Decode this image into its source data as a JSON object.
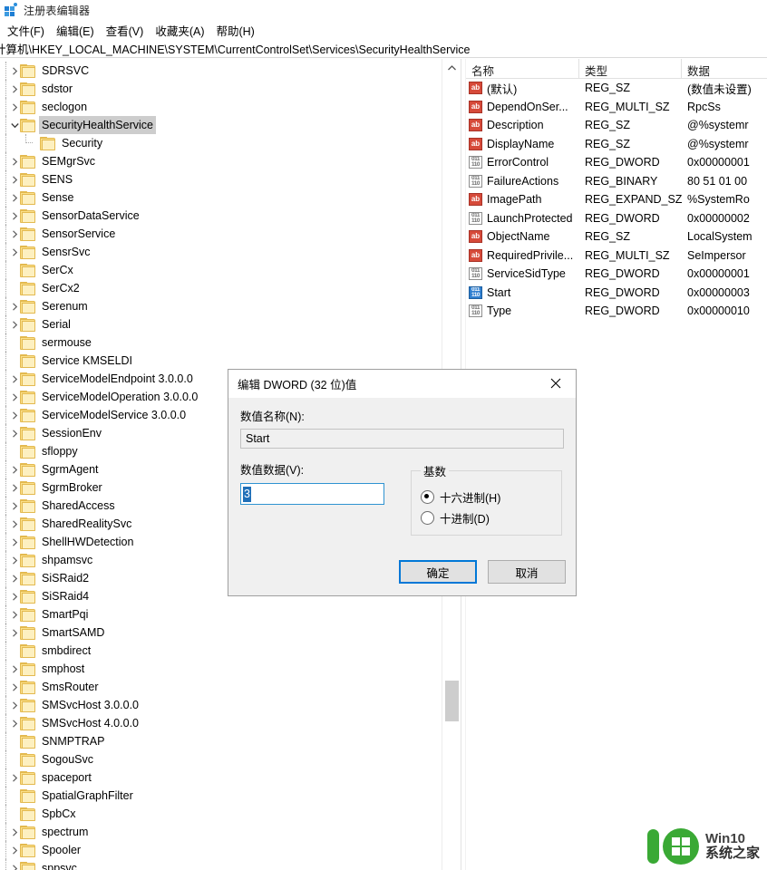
{
  "window": {
    "title": "注册表编辑器",
    "icon": "registry-editor-icon"
  },
  "menu": {
    "items": [
      {
        "label": "文件(F)",
        "name": "menu-file"
      },
      {
        "label": "编辑(E)",
        "name": "menu-edit"
      },
      {
        "label": "查看(V)",
        "name": "menu-view"
      },
      {
        "label": "收藏夹(A)",
        "name": "menu-favorites"
      },
      {
        "label": "帮助(H)",
        "name": "menu-help"
      }
    ]
  },
  "address": {
    "path": "计算机\\HKEY_LOCAL_MACHINE\\SYSTEM\\CurrentControlSet\\Services\\SecurityHealthService"
  },
  "tree": {
    "items": [
      {
        "label": "SDRSVC",
        "indent": 1,
        "expander": "collapsed",
        "selected": false
      },
      {
        "label": "sdstor",
        "indent": 1,
        "expander": "collapsed",
        "selected": false
      },
      {
        "label": "seclogon",
        "indent": 1,
        "expander": "collapsed",
        "selected": false
      },
      {
        "label": "SecurityHealthService",
        "indent": 1,
        "expander": "expanded",
        "selected": true
      },
      {
        "label": "Security",
        "indent": 2,
        "expander": "leaf",
        "selected": false
      },
      {
        "label": "SEMgrSvc",
        "indent": 1,
        "expander": "collapsed",
        "selected": false
      },
      {
        "label": "SENS",
        "indent": 1,
        "expander": "collapsed",
        "selected": false
      },
      {
        "label": "Sense",
        "indent": 1,
        "expander": "collapsed",
        "selected": false
      },
      {
        "label": "SensorDataService",
        "indent": 1,
        "expander": "collapsed",
        "selected": false
      },
      {
        "label": "SensorService",
        "indent": 1,
        "expander": "collapsed",
        "selected": false
      },
      {
        "label": "SensrSvc",
        "indent": 1,
        "expander": "collapsed",
        "selected": false
      },
      {
        "label": "SerCx",
        "indent": 1,
        "expander": "leaf",
        "selected": false
      },
      {
        "label": "SerCx2",
        "indent": 1,
        "expander": "leaf",
        "selected": false
      },
      {
        "label": "Serenum",
        "indent": 1,
        "expander": "collapsed",
        "selected": false
      },
      {
        "label": "Serial",
        "indent": 1,
        "expander": "collapsed",
        "selected": false
      },
      {
        "label": "sermouse",
        "indent": 1,
        "expander": "leaf",
        "selected": false
      },
      {
        "label": "Service KMSELDI",
        "indent": 1,
        "expander": "leaf",
        "selected": false
      },
      {
        "label": "ServiceModelEndpoint 3.0.0.0",
        "indent": 1,
        "expander": "collapsed",
        "selected": false
      },
      {
        "label": "ServiceModelOperation 3.0.0.0",
        "indent": 1,
        "expander": "collapsed",
        "selected": false
      },
      {
        "label": "ServiceModelService 3.0.0.0",
        "indent": 1,
        "expander": "collapsed",
        "selected": false
      },
      {
        "label": "SessionEnv",
        "indent": 1,
        "expander": "collapsed",
        "selected": false
      },
      {
        "label": "sfloppy",
        "indent": 1,
        "expander": "leaf",
        "selected": false
      },
      {
        "label": "SgrmAgent",
        "indent": 1,
        "expander": "collapsed",
        "selected": false
      },
      {
        "label": "SgrmBroker",
        "indent": 1,
        "expander": "collapsed",
        "selected": false
      },
      {
        "label": "SharedAccess",
        "indent": 1,
        "expander": "collapsed",
        "selected": false
      },
      {
        "label": "SharedRealitySvc",
        "indent": 1,
        "expander": "collapsed",
        "selected": false
      },
      {
        "label": "ShellHWDetection",
        "indent": 1,
        "expander": "collapsed",
        "selected": false
      },
      {
        "label": "shpamsvc",
        "indent": 1,
        "expander": "collapsed",
        "selected": false
      },
      {
        "label": "SiSRaid2",
        "indent": 1,
        "expander": "collapsed",
        "selected": false
      },
      {
        "label": "SiSRaid4",
        "indent": 1,
        "expander": "collapsed",
        "selected": false
      },
      {
        "label": "SmartPqi",
        "indent": 1,
        "expander": "collapsed",
        "selected": false
      },
      {
        "label": "SmartSAMD",
        "indent": 1,
        "expander": "collapsed",
        "selected": false
      },
      {
        "label": "smbdirect",
        "indent": 1,
        "expander": "leaf",
        "selected": false
      },
      {
        "label": "smphost",
        "indent": 1,
        "expander": "collapsed",
        "selected": false
      },
      {
        "label": "SmsRouter",
        "indent": 1,
        "expander": "collapsed",
        "selected": false
      },
      {
        "label": "SMSvcHost 3.0.0.0",
        "indent": 1,
        "expander": "collapsed",
        "selected": false
      },
      {
        "label": "SMSvcHost 4.0.0.0",
        "indent": 1,
        "expander": "collapsed",
        "selected": false
      },
      {
        "label": "SNMPTRAP",
        "indent": 1,
        "expander": "leaf",
        "selected": false
      },
      {
        "label": "SogouSvc",
        "indent": 1,
        "expander": "leaf",
        "selected": false
      },
      {
        "label": "spaceport",
        "indent": 1,
        "expander": "collapsed",
        "selected": false
      },
      {
        "label": "SpatialGraphFilter",
        "indent": 1,
        "expander": "leaf",
        "selected": false
      },
      {
        "label": "SpbCx",
        "indent": 1,
        "expander": "leaf",
        "selected": false
      },
      {
        "label": "spectrum",
        "indent": 1,
        "expander": "collapsed",
        "selected": false
      },
      {
        "label": "Spooler",
        "indent": 1,
        "expander": "collapsed",
        "selected": false
      },
      {
        "label": "sppsvc",
        "indent": 1,
        "expander": "collapsed",
        "selected": false
      }
    ]
  },
  "listview": {
    "columns": [
      {
        "label": "名称",
        "name": "column-name"
      },
      {
        "label": "类型",
        "name": "column-type"
      },
      {
        "label": "数据",
        "name": "column-data"
      }
    ],
    "rows": [
      {
        "icon": "string-value-icon",
        "iconKind": "ab",
        "name": "(默认)",
        "type": "REG_SZ",
        "data": "(数值未设置)"
      },
      {
        "icon": "string-value-icon",
        "iconKind": "ab",
        "name": "DependOnSer...",
        "type": "REG_MULTI_SZ",
        "data": "RpcSs"
      },
      {
        "icon": "string-value-icon",
        "iconKind": "ab",
        "name": "Description",
        "type": "REG_SZ",
        "data": "@%systemr"
      },
      {
        "icon": "string-value-icon",
        "iconKind": "ab",
        "name": "DisplayName",
        "type": "REG_SZ",
        "data": "@%systemr"
      },
      {
        "icon": "binary-value-icon",
        "iconKind": "bin",
        "name": "ErrorControl",
        "type": "REG_DWORD",
        "data": "0x00000001"
      },
      {
        "icon": "binary-value-icon",
        "iconKind": "bin",
        "name": "FailureActions",
        "type": "REG_BINARY",
        "data": "80 51 01 00"
      },
      {
        "icon": "string-value-icon",
        "iconKind": "ab",
        "name": "ImagePath",
        "type": "REG_EXPAND_SZ",
        "data": "%SystemRo"
      },
      {
        "icon": "binary-value-icon",
        "iconKind": "bin",
        "name": "LaunchProtected",
        "type": "REG_DWORD",
        "data": "0x00000002"
      },
      {
        "icon": "string-value-icon",
        "iconKind": "ab",
        "name": "ObjectName",
        "type": "REG_SZ",
        "data": "LocalSystem"
      },
      {
        "icon": "string-value-icon",
        "iconKind": "ab",
        "name": "RequiredPrivile...",
        "type": "REG_MULTI_SZ",
        "data": "SeImpersor"
      },
      {
        "icon": "binary-value-icon",
        "iconKind": "bin",
        "name": "ServiceSidType",
        "type": "REG_DWORD",
        "data": "0x00000001"
      },
      {
        "icon": "binary-value-icon",
        "iconKind": "bin-selected",
        "name": "Start",
        "type": "REG_DWORD",
        "data": "0x00000003"
      },
      {
        "icon": "binary-value-icon",
        "iconKind": "bin",
        "name": "Type",
        "type": "REG_DWORD",
        "data": "0x00000010"
      }
    ]
  },
  "dialog": {
    "title": "编辑 DWORD (32 位)值",
    "close_icon": "close-icon",
    "name_label": "数值名称(N):",
    "name_value": "Start",
    "data_label": "数值数据(V):",
    "data_value": "3",
    "base_legend": "基数",
    "base_options": [
      {
        "label": "十六进制(H)",
        "checked": true,
        "name": "radio-hexadecimal"
      },
      {
        "label": "十进制(D)",
        "checked": false,
        "name": "radio-decimal"
      }
    ],
    "ok_label": "确定",
    "cancel_label": "取消"
  },
  "watermark": {
    "line1": "Win10",
    "line2": "系统之家",
    "color": "#3aa935"
  }
}
